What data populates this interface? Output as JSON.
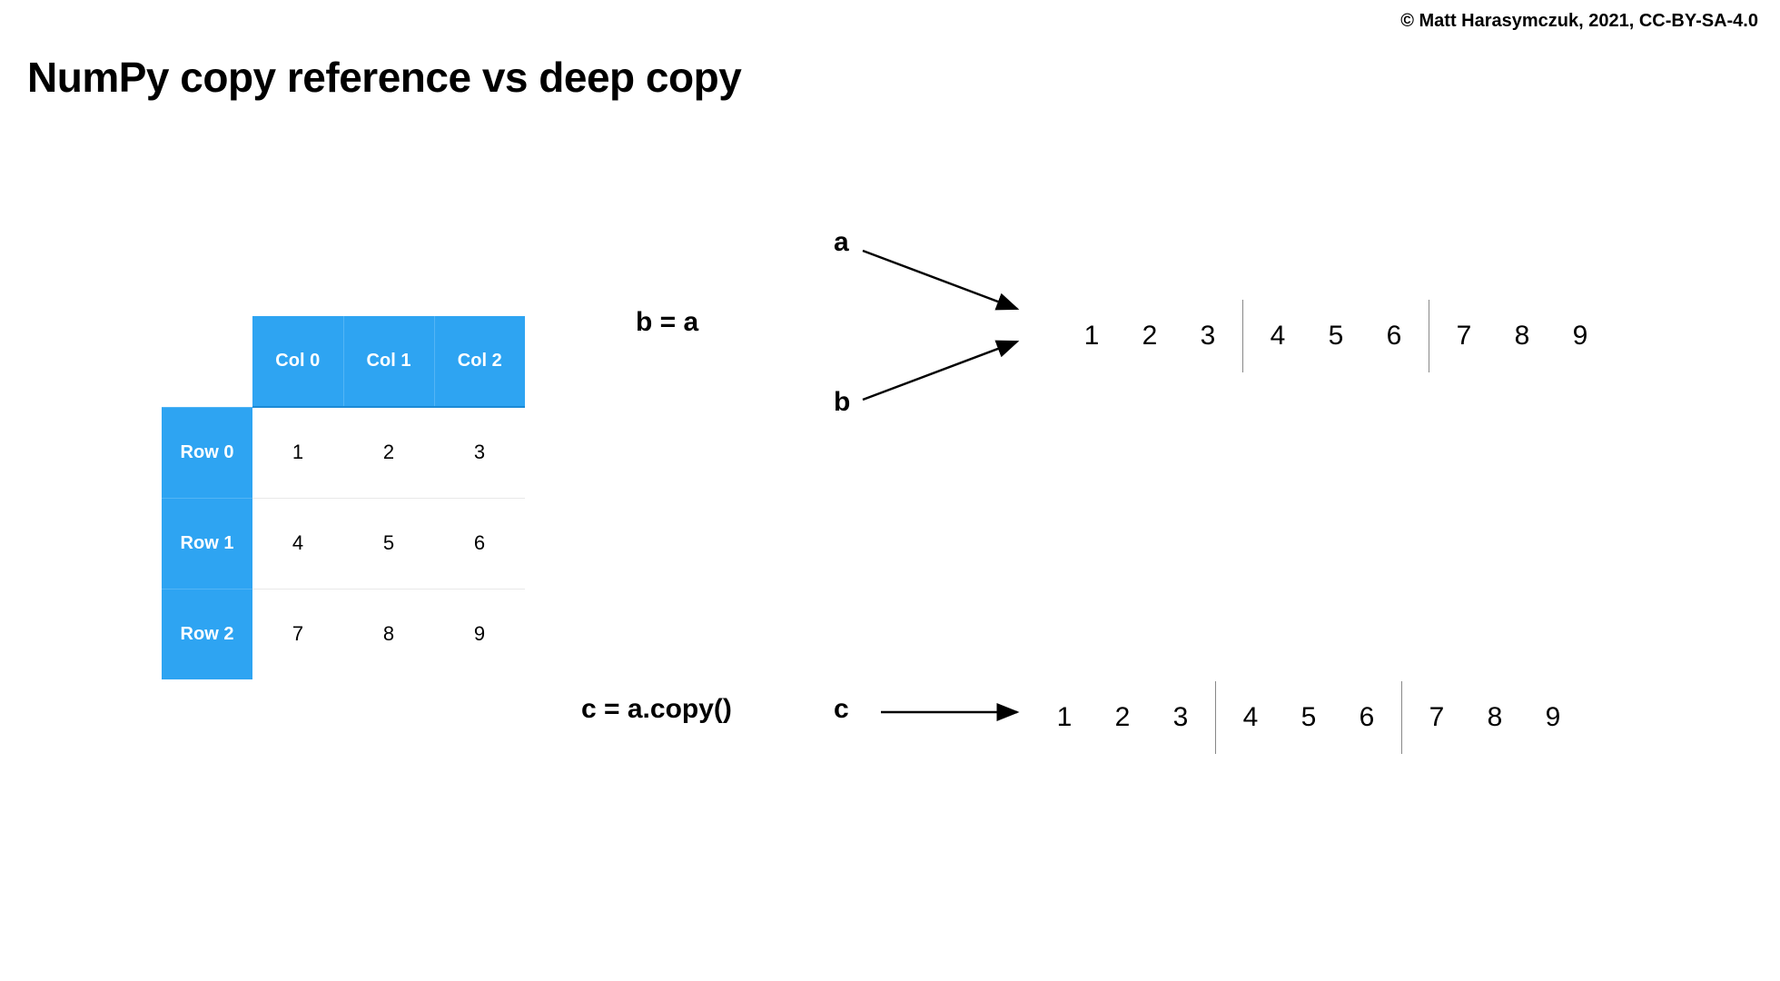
{
  "copyright": "© Matt Harasymczuk, 2021, CC-BY-SA-4.0",
  "title": "NumPy copy reference vs deep copy",
  "table": {
    "col_headers": [
      "Col 0",
      "Col 1",
      "Col 2"
    ],
    "row_headers": [
      "Row 0",
      "Row 1",
      "Row 2"
    ],
    "cells": [
      [
        "1",
        "2",
        "3"
      ],
      [
        "4",
        "5",
        "6"
      ],
      [
        "7",
        "8",
        "9"
      ]
    ]
  },
  "reference": {
    "code": "b = a",
    "var_top": "a",
    "var_bottom": "b",
    "memory": [
      "1",
      "2",
      "3",
      "4",
      "5",
      "6",
      "7",
      "8",
      "9"
    ]
  },
  "deepcopy": {
    "code": "c = a.copy()",
    "var": "c",
    "memory": [
      "1",
      "2",
      "3",
      "4",
      "5",
      "6",
      "7",
      "8",
      "9"
    ]
  }
}
